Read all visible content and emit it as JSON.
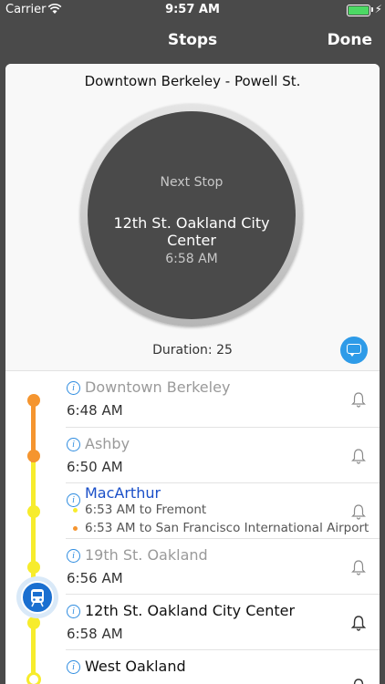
{
  "status_bar": {
    "carrier": "Carrier",
    "time": "9:57 AM"
  },
  "nav": {
    "title": "Stops",
    "done_label": "Done"
  },
  "route": {
    "title": "Downtown Berkeley - Powell St."
  },
  "next_stop": {
    "label": "Next Stop",
    "name": "12th St. Oakland City Center",
    "time": "6:58 AM"
  },
  "duration": "Duration: 25",
  "colors": {
    "orange_line": "#f5952f",
    "yellow_line": "#f7ec2c",
    "accent": "#2e9be8",
    "link": "#1a4fc8"
  },
  "stops": [
    {
      "name": "Downtown Berkeley",
      "time": "6:48 AM"
    },
    {
      "name": "Ashby",
      "time": "6:50 AM"
    },
    {
      "name": "MacArthur",
      "transfers": [
        "6:53 AM to Fremont",
        "6:53 AM to San Francisco International Airport"
      ]
    },
    {
      "name": "19th St. Oakland",
      "time": "6:56 AM"
    },
    {
      "name": "12th St. Oakland City Center",
      "time": "6:58 AM"
    },
    {
      "name": "West Oakland",
      "time": ""
    }
  ],
  "icons": {
    "info": "i",
    "bell": "bell-icon",
    "chat": "chat-icon",
    "train": "train-icon",
    "wifi": "wifi-icon",
    "battery": "battery-icon",
    "charging": "⚡"
  }
}
